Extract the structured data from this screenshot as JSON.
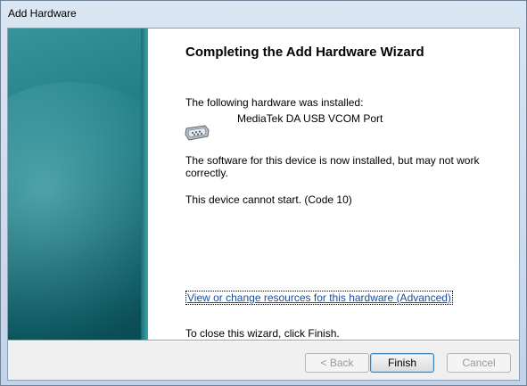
{
  "window": {
    "title": "Add Hardware"
  },
  "wizard": {
    "heading": "Completing the Add Hardware Wizard",
    "installed_label": "The following hardware was installed:",
    "device_name": "MediaTek DA USB VCOM Port",
    "device_icon": "serial-port-icon",
    "status_line1": "The software for this device is now installed, but may not work",
    "status_line2": "correctly.",
    "error_text": "This device cannot start. (Code 10)",
    "resources_link": "View or change resources for this hardware (Advanced)",
    "close_hint": "To close this wizard, click Finish."
  },
  "buttons": {
    "back": "< Back",
    "finish": "Finish",
    "cancel": "Cancel"
  },
  "colors": {
    "banner": "#1f7a82",
    "link": "#1a4e99"
  }
}
